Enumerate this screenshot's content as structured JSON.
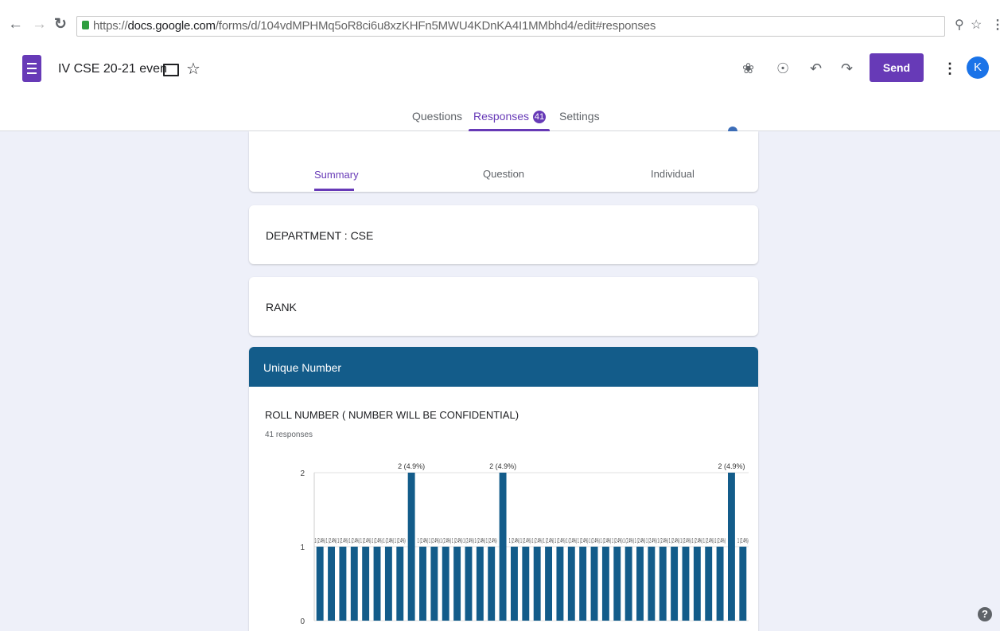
{
  "browser": {
    "back_icon": "arrow-left-icon",
    "forward_icon": "arrow-right-icon",
    "reload_icon": "reload-icon",
    "url_prefix": "https://",
    "url_host": "docs.google.com",
    "url_path": "/forms/d/104vdMPHMq5oR8ci6u8xzKHFn5MWU4KDnKA4I1MMbhd4/edit#responses"
  },
  "header": {
    "doc_title": "IV CSE 20-21 even",
    "send_label": "Send",
    "avatar_letter": "K"
  },
  "tabs": {
    "questions": "Questions",
    "responses": "Responses",
    "responses_count": "41",
    "settings": "Settings"
  },
  "summary_tabs": {
    "summary": "Summary",
    "question": "Question",
    "individual": "Individual"
  },
  "cards": {
    "department": "DEPARTMENT : CSE",
    "rank": "RANK"
  },
  "section": {
    "title": "Unique Number",
    "question": "ROLL NUMBER ( NUMBER WILL BE CONFIDENTIAL)",
    "responses": "41 responses"
  },
  "colors": {
    "accent": "#673ab7",
    "section_header": "#135c8a",
    "bar": "#135c8a"
  },
  "chart_data": {
    "type": "bar",
    "ylim": [
      0,
      2
    ],
    "yticks": [
      "0",
      "1",
      "2"
    ],
    "values": [
      1,
      1,
      1,
      1,
      1,
      1,
      1,
      1,
      2,
      1,
      1,
      1,
      1,
      1,
      1,
      1,
      2,
      1,
      1,
      1,
      1,
      1,
      1,
      1,
      1,
      1,
      1,
      1,
      1,
      1,
      1,
      1,
      1,
      1,
      1,
      1,
      2,
      1
    ],
    "bar_labels": [
      "1 (2.4%)",
      "2 (4.9%)"
    ]
  }
}
